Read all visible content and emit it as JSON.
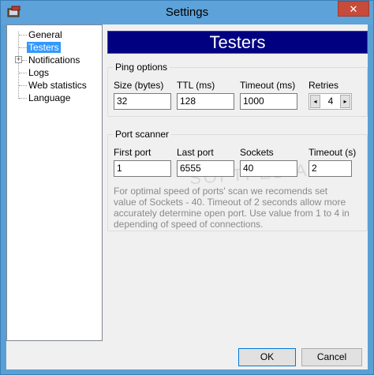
{
  "window": {
    "title": "Settings",
    "close_glyph": "✕"
  },
  "tree": {
    "items": [
      {
        "label": "General"
      },
      {
        "label": "Testers",
        "selected": true
      },
      {
        "label": "Notifications",
        "expandable": true
      },
      {
        "label": "Logs"
      },
      {
        "label": "Web statistics"
      },
      {
        "label": "Language"
      }
    ],
    "expander_glyph": "+"
  },
  "page": {
    "header": "Testers"
  },
  "ping_options": {
    "title": "Ping options",
    "size_label": "Size (bytes)",
    "size_value": "32",
    "ttl_label": "TTL (ms)",
    "ttl_value": "128",
    "timeout_label": "Timeout (ms)",
    "timeout_value": "1000",
    "retries_label": "Retries",
    "retries_value": "4"
  },
  "port_scanner": {
    "title": "Port scanner",
    "first_port_label": "First port",
    "first_port_value": "1",
    "last_port_label": "Last port",
    "last_port_value": "6555",
    "sockets_label": "Sockets",
    "sockets_value": "40",
    "timeout_label": "Timeout (s)",
    "timeout_value": "2",
    "help": "For optimal speed of ports' scan we recomends set value of Sockets - 40. Timeout of 2 seconds allow more accurately determine open port. Use value from 1 to 4 in depending of speed of connections."
  },
  "buttons": {
    "ok": "OK",
    "cancel": "Cancel"
  },
  "watermark": "SOFTPEDIA",
  "icons": {
    "spin_left": "◂",
    "spin_right": "▸",
    "app": "app-icon"
  },
  "colors": {
    "header_bg": "#000080",
    "selection": "#3399ff",
    "titlebar": "#5da2d8"
  }
}
